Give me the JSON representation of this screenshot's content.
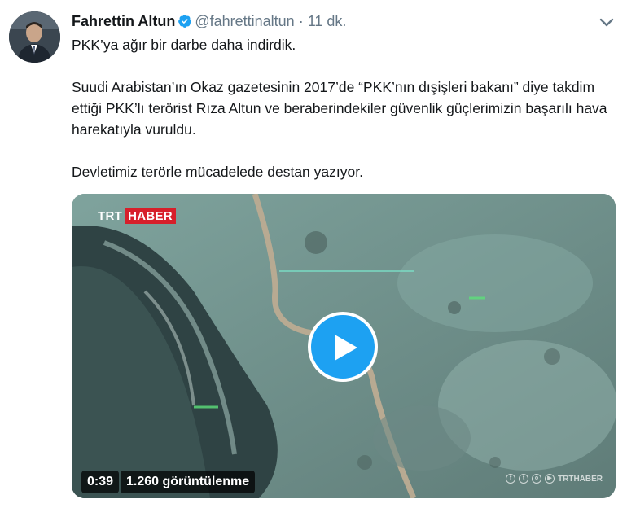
{
  "author": {
    "name": "Fahrettin Altun",
    "handle": "@fahrettinaltun",
    "separator": "·",
    "time": "11 dk."
  },
  "tweet": {
    "text": "PKK’ya ağır bir darbe daha indirdik.\n\nSuudi Arabistan’ın Okaz gazetesinin 2017’de “PKK’nın dışişleri bakanı” diye takdim ettiği PKK’lı terörist Rıza Altun ve beraberindekiler güvenlik güçlerimizin başarılı hava harekatıyla vuruldu.\n\nDevletimiz terörle mücadelede destan yazıyor."
  },
  "video": {
    "logo_trt": "TRT",
    "logo_haber": "HABER",
    "duration": "0:39",
    "views": "1.260 görüntülenme",
    "watermark": "TRTHABER"
  },
  "colors": {
    "accent": "#1da1f2",
    "muted": "#657786",
    "text": "#14171a",
    "trt_red": "#d71f2a"
  },
  "icons": [
    "verified-badge-icon",
    "chevron-down-icon",
    "play-icon"
  ]
}
